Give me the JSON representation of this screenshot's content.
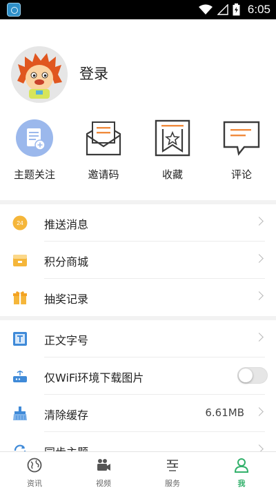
{
  "status_bar": {
    "time": "6:05"
  },
  "profile": {
    "login_label": "登录",
    "quick_actions": [
      {
        "label": "主题关注",
        "icon": "topic-follow-icon"
      },
      {
        "label": "邀请码",
        "icon": "invite-envelope-icon"
      },
      {
        "label": "收藏",
        "icon": "favorite-star-icon"
      },
      {
        "label": "评论",
        "icon": "comment-bubble-icon"
      }
    ]
  },
  "menu_group_1": [
    {
      "label": "推送消息",
      "icon": "push-badge-icon",
      "badge": "24"
    },
    {
      "label": "积分商城",
      "icon": "points-mall-icon"
    },
    {
      "label": "抽奖记录",
      "icon": "gift-icon"
    }
  ],
  "menu_group_2": [
    {
      "label": "正文字号",
      "icon": "font-size-icon"
    },
    {
      "label": "仅WiFi环境下载图片",
      "icon": "router-icon",
      "toggle_on": false
    },
    {
      "label": "清除缓存",
      "icon": "broom-icon",
      "value": "6.61MB"
    },
    {
      "label": "同步主题",
      "icon": "sync-icon"
    }
  ],
  "tabbar": {
    "tabs": [
      {
        "label": "资讯",
        "icon": "globe-icon"
      },
      {
        "label": "视频",
        "icon": "video-camera-icon"
      },
      {
        "label": "服务",
        "icon": "service-list-icon"
      },
      {
        "label": "我",
        "icon": "person-icon",
        "active": true
      }
    ]
  },
  "colors": {
    "accent_green": "#31b06a",
    "accent_orange": "#f08a3c",
    "icon_blue": "#3f8ad8"
  }
}
